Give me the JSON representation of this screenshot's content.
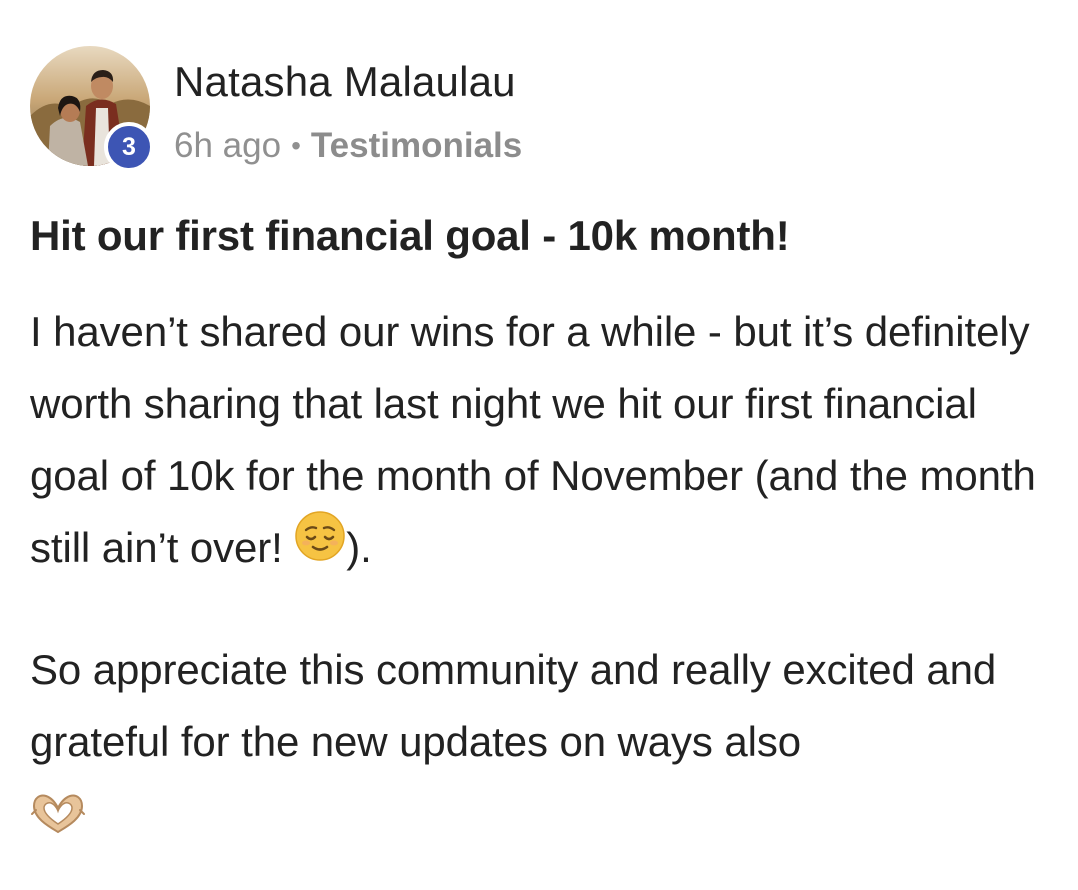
{
  "author": {
    "name": "Natasha Malaulau",
    "level": "3",
    "avatar_icon": "profile-photo-couple"
  },
  "meta": {
    "time_ago": "6h ago",
    "separator": "•",
    "category": "Testimonials"
  },
  "post": {
    "title": "Hit our first financial goal - 10k month!",
    "paragraph1_text": "I haven’t shared our wins for a while - but it’s definitely worth sharing that last night we hit our first financial goal of 10k for the month of November (and the month still ain’t over! ",
    "paragraph1_emoji": "relieved-face-icon",
    "paragraph1_suffix": ").",
    "paragraph2_text": "So appreciate this community and really excited and grateful for the new updates on ways also",
    "paragraph2_emoji": "heart-hands-icon"
  },
  "colors": {
    "badge": "#3d55b4",
    "text": "#222222",
    "meta_text": "#909090"
  }
}
